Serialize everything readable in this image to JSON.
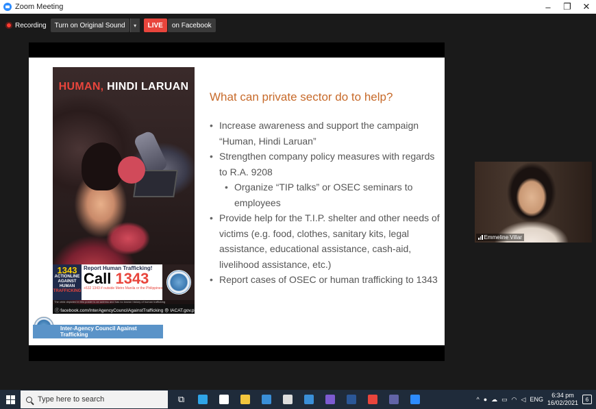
{
  "window": {
    "title": "Zoom Meeting",
    "controls": {
      "minimize": "–",
      "restore": "❐",
      "close": "✕"
    }
  },
  "meeting_bar": {
    "recording_label": "Recording",
    "original_sound_label": "Turn on Original Sound",
    "caret": "▾",
    "live_label": "LIVE",
    "live_target": "on Facebook"
  },
  "slide": {
    "heading": "What can private sector do to help?",
    "bullets": [
      {
        "text": "Increase awareness and support the campaign “Human, Hindi Laruan”",
        "level": 1
      },
      {
        "text": "Strengthen company policy measures with regards to R.A. 9208",
        "level": 1
      },
      {
        "text": "Organize “TIP talks” or OSEC seminars to employees",
        "level": 2
      },
      {
        "text": "Provide help for the T.I.P. shelter and other needs of victims (e.g. food, clothes, sanitary kits, legal assistance, educational assistance, cash-aid, livelihood assistance, etc.)",
        "level": 1
      },
      {
        "text": "Report cases of OSEC or human trafficking to 1343",
        "level": 1
      }
    ],
    "poster": {
      "title_red": "HUMAN,",
      "title_white": " HINDI LARUAN",
      "hotline_number": "1343",
      "hotline_actionline": "ACTIONLINE",
      "hotline_against": "AGAINST HUMAN",
      "hotline_trafficking": "TRAFFICKING",
      "report_label": "Report Human Trafficking!",
      "call_prefix": "Call ",
      "call_number": "1343",
      "call_sub": "+632 1343 if outside Metro Manila or the Philippines",
      "disclaimer": "The child depicted in this poster is an actress and has no known history of human trafficking",
      "footer": "ⓕ facebook.com/InterAgencyCouncilAgainstTrafficking ⊕ IACAT.gov.ph",
      "agency_label": "Inter-Agency Council Against Trafficking"
    }
  },
  "participant": {
    "name": "Emmeline Villar",
    "bg_color": "#2c2420"
  },
  "taskbar": {
    "search_placeholder": "Type here to search",
    "apps": [
      {
        "icon": "task-view-icon",
        "glyph": "⧉",
        "color": "#ffffff"
      },
      {
        "icon": "edge-icon",
        "glyph": "",
        "color": "#2fa4e7"
      },
      {
        "icon": "store-icon",
        "glyph": "",
        "color": "#ffffff"
      },
      {
        "icon": "file-explorer-icon",
        "glyph": "",
        "color": "#f2c53d"
      },
      {
        "icon": "mail-icon",
        "glyph": "",
        "color": "#3a8fd8"
      },
      {
        "icon": "vpn-icon",
        "glyph": "",
        "color": "#dddddd"
      },
      {
        "icon": "ie-icon",
        "glyph": "",
        "color": "#3a8fd8"
      },
      {
        "icon": "viber-icon",
        "glyph": "",
        "color": "#7d5bd1"
      },
      {
        "icon": "word-icon",
        "glyph": "",
        "color": "#2b5797"
      },
      {
        "icon": "chrome-icon",
        "glyph": "",
        "color": "#e8453c"
      },
      {
        "icon": "teams-icon",
        "glyph": "",
        "color": "#6264a7"
      },
      {
        "icon": "zoom-icon",
        "glyph": "",
        "color": "#2d8cff"
      }
    ],
    "tray": {
      "chevron": "^",
      "lang": "ENG",
      "time": "6:34 pm",
      "date": "16/02/2021",
      "notifications": "6"
    }
  }
}
